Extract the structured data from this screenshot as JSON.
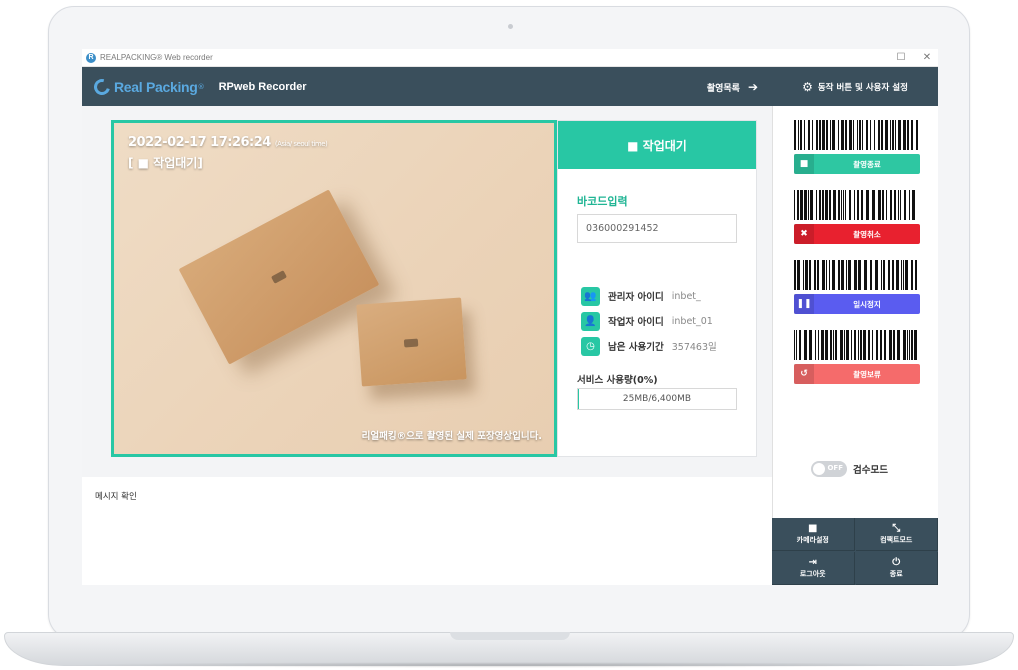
{
  "window": {
    "title": "REALPACKING® Web recorder",
    "icon": "app-icon",
    "minimize": "☐",
    "close": "✕"
  },
  "header": {
    "brand": "Real Packing",
    "brand_super": "®",
    "app_name": "RPweb Recorder",
    "recording_list": "촬영목록",
    "settings": "동작 버튼 및 사용자 설정"
  },
  "preview": {
    "timestamp": "2022-02-17 17:26:24",
    "timezone": "(Asia/ seoul time)",
    "status": "[ ■ 작업대기]",
    "caption": "리얼패킹®으로 촬영된 실제 포장영상입니다."
  },
  "info": {
    "status_title": "■ 작업대기",
    "barcode_label": "바코드입력",
    "barcode_value": "036000291452",
    "rows": [
      {
        "icon": "manager-icon",
        "glyph": "👥",
        "key": "관리자 아이디",
        "value": "inbet_"
      },
      {
        "icon": "worker-icon",
        "glyph": "👤",
        "key": "작업자 아이디",
        "value": "inbet_01"
      },
      {
        "icon": "clock-icon",
        "glyph": "◷",
        "key": "남은 사용기간",
        "value": "357463일"
      }
    ],
    "usage_label": "서비스 사용량(0%)",
    "usage_text": "25MB/6,400MB",
    "usage_fraction": 0.004
  },
  "message": {
    "title": "메시지 확인"
  },
  "controls": [
    {
      "name": "stop-recording",
      "label": "촬영종료",
      "glyph": "■",
      "color": "#2ec7a2"
    },
    {
      "name": "cancel-recording",
      "label": "촬영취소",
      "glyph": "✖",
      "color": "#e8212f"
    },
    {
      "name": "pause",
      "label": "일시정지",
      "glyph": "❚❚",
      "color": "#5a5cf0"
    },
    {
      "name": "hold-recording",
      "label": "촬영보류",
      "glyph": "↺",
      "color": "#f56b6b"
    }
  ],
  "inspection": {
    "toggle_state": "OFF",
    "label": "검수모드"
  },
  "bottom": [
    {
      "name": "camera-settings",
      "icon": "camera-icon",
      "glyph": "■",
      "label": "카메라설정"
    },
    {
      "name": "compact-mode",
      "icon": "compact-icon",
      "glyph": "⤡",
      "label": "컴팩트모드"
    },
    {
      "name": "logout",
      "icon": "logout-icon",
      "glyph": "⇥",
      "label": "로그아웃"
    },
    {
      "name": "exit",
      "icon": "power-icon",
      "glyph": "⏻",
      "label": "종료"
    }
  ]
}
